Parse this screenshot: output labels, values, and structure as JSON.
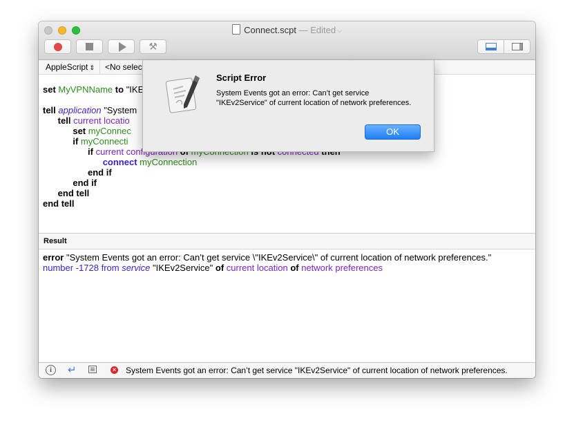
{
  "window": {
    "title": "Connect.scpt",
    "edited": "— Edited"
  },
  "navbar": {
    "language": "AppleScript",
    "selector": "<No select"
  },
  "code": [
    [
      {
        "t": "set",
        "c": "kw"
      },
      {
        "t": " "
      },
      {
        "t": "MyVPNName",
        "c": "var"
      },
      {
        "t": " "
      },
      {
        "t": "to",
        "c": "kw"
      },
      {
        "t": " \"IKE"
      }
    ],
    [],
    [
      {
        "t": "tell",
        "c": "kw"
      },
      {
        "t": " "
      },
      {
        "t": "application",
        "c": "app"
      },
      {
        "t": " \"System"
      }
    ],
    [
      {
        "t": "      "
      },
      {
        "t": "tell",
        "c": "kw"
      },
      {
        "t": " "
      },
      {
        "t": "current locatio",
        "c": "cls"
      }
    ],
    [
      {
        "t": "            "
      },
      {
        "t": "set",
        "c": "kw"
      },
      {
        "t": " "
      },
      {
        "t": "myConnec",
        "c": "var"
      }
    ],
    [
      {
        "t": "            "
      },
      {
        "t": "if",
        "c": "kw"
      },
      {
        "t": " "
      },
      {
        "t": "myConnecti",
        "c": "var"
      }
    ],
    [
      {
        "t": "                  "
      },
      {
        "t": "if",
        "c": "kw"
      },
      {
        "t": " "
      },
      {
        "t": "current configuration",
        "c": "cls"
      },
      {
        "t": " "
      },
      {
        "t": "of",
        "c": "kw"
      },
      {
        "t": " "
      },
      {
        "t": "myConnection",
        "c": "var"
      },
      {
        "t": " "
      },
      {
        "t": "is not",
        "c": "kw"
      },
      {
        "t": " "
      },
      {
        "t": "connected",
        "c": "cls"
      },
      {
        "t": " "
      },
      {
        "t": "then",
        "c": "kw"
      }
    ],
    [
      {
        "t": "                        "
      },
      {
        "t": "connect",
        "c": "cmd"
      },
      {
        "t": " "
      },
      {
        "t": "myConnection",
        "c": "var"
      }
    ],
    [
      {
        "t": "                  "
      },
      {
        "t": "end if",
        "c": "kw"
      }
    ],
    [
      {
        "t": "            "
      },
      {
        "t": "end if",
        "c": "kw"
      }
    ],
    [
      {
        "t": "      "
      },
      {
        "t": "end tell",
        "c": "kw"
      }
    ],
    [
      {
        "t": "end tell",
        "c": "kw"
      }
    ]
  ],
  "result": {
    "header": "Result",
    "line1": {
      "kw": "error",
      "text": " \"System Events got an error: Can’t get service \\\"IKEv2Service\\\" of current location of network preferences.\""
    },
    "line2": [
      {
        "t": "number -1728",
        "c": "num"
      },
      {
        "t": " "
      },
      {
        "t": "from",
        "c": "num"
      },
      {
        "t": " "
      },
      {
        "t": "service",
        "c": "svc"
      },
      {
        "t": " \"IKEv2Service\" "
      },
      {
        "t": "of",
        "c": "kw"
      },
      {
        "t": " "
      },
      {
        "t": "current location",
        "c": "cls"
      },
      {
        "t": " "
      },
      {
        "t": "of",
        "c": "kw"
      },
      {
        "t": " "
      },
      {
        "t": "network preferences",
        "c": "cls"
      }
    ]
  },
  "status": {
    "message": "System Events got an error: Can’t get service \"IKEv2Service\" of current location of network preferences."
  },
  "dialog": {
    "title": "Script Error",
    "message": "System Events got an error: Can’t get service \"IKEv2Service\" of current location of network preferences.",
    "ok_label": "OK"
  },
  "colors": {
    "variable": "#2e8b1d",
    "class": "#7d22c8",
    "command": "#3a1ed0",
    "accent": "#1f7ff5",
    "error": "#e0262a"
  },
  "icons": [
    "record-icon",
    "stop-icon",
    "run-icon",
    "compile-icon",
    "bottom-pane-icon",
    "side-pane-icon",
    "info-icon",
    "reply-icon",
    "list-icon",
    "error-icon",
    "script-editor-icon"
  ]
}
